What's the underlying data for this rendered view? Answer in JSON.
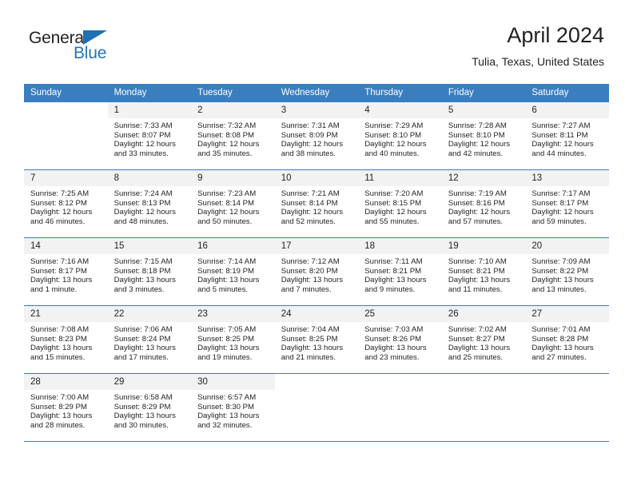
{
  "brand": {
    "word_one": "General",
    "word_two": "Blue",
    "flag_icon": "blue-triangle-flag-icon"
  },
  "header": {
    "title": "April 2024",
    "subtitle": "Tulia, Texas, United States"
  },
  "theme": {
    "header_blue": "#3a7ebf",
    "daynum_gray": "#f2f2f2",
    "brand_blue": "#2176b9",
    "text": "#231f20"
  },
  "weekday_headers": [
    "Sunday",
    "Monday",
    "Tuesday",
    "Wednesday",
    "Thursday",
    "Friday",
    "Saturday"
  ],
  "weeks": [
    [
      {
        "day": "",
        "sunrise": "",
        "sunset": "",
        "daylight1": "",
        "daylight2": "",
        "blank": true
      },
      {
        "day": "1",
        "sunrise": "Sunrise: 7:33 AM",
        "sunset": "Sunset: 8:07 PM",
        "daylight1": "Daylight: 12 hours",
        "daylight2": "and 33 minutes."
      },
      {
        "day": "2",
        "sunrise": "Sunrise: 7:32 AM",
        "sunset": "Sunset: 8:08 PM",
        "daylight1": "Daylight: 12 hours",
        "daylight2": "and 35 minutes."
      },
      {
        "day": "3",
        "sunrise": "Sunrise: 7:31 AM",
        "sunset": "Sunset: 8:09 PM",
        "daylight1": "Daylight: 12 hours",
        "daylight2": "and 38 minutes."
      },
      {
        "day": "4",
        "sunrise": "Sunrise: 7:29 AM",
        "sunset": "Sunset: 8:10 PM",
        "daylight1": "Daylight: 12 hours",
        "daylight2": "and 40 minutes."
      },
      {
        "day": "5",
        "sunrise": "Sunrise: 7:28 AM",
        "sunset": "Sunset: 8:10 PM",
        "daylight1": "Daylight: 12 hours",
        "daylight2": "and 42 minutes."
      },
      {
        "day": "6",
        "sunrise": "Sunrise: 7:27 AM",
        "sunset": "Sunset: 8:11 PM",
        "daylight1": "Daylight: 12 hours",
        "daylight2": "and 44 minutes."
      }
    ],
    [
      {
        "day": "7",
        "sunrise": "Sunrise: 7:25 AM",
        "sunset": "Sunset: 8:12 PM",
        "daylight1": "Daylight: 12 hours",
        "daylight2": "and 46 minutes."
      },
      {
        "day": "8",
        "sunrise": "Sunrise: 7:24 AM",
        "sunset": "Sunset: 8:13 PM",
        "daylight1": "Daylight: 12 hours",
        "daylight2": "and 48 minutes."
      },
      {
        "day": "9",
        "sunrise": "Sunrise: 7:23 AM",
        "sunset": "Sunset: 8:14 PM",
        "daylight1": "Daylight: 12 hours",
        "daylight2": "and 50 minutes."
      },
      {
        "day": "10",
        "sunrise": "Sunrise: 7:21 AM",
        "sunset": "Sunset: 8:14 PM",
        "daylight1": "Daylight: 12 hours",
        "daylight2": "and 52 minutes."
      },
      {
        "day": "11",
        "sunrise": "Sunrise: 7:20 AM",
        "sunset": "Sunset: 8:15 PM",
        "daylight1": "Daylight: 12 hours",
        "daylight2": "and 55 minutes."
      },
      {
        "day": "12",
        "sunrise": "Sunrise: 7:19 AM",
        "sunset": "Sunset: 8:16 PM",
        "daylight1": "Daylight: 12 hours",
        "daylight2": "and 57 minutes."
      },
      {
        "day": "13",
        "sunrise": "Sunrise: 7:17 AM",
        "sunset": "Sunset: 8:17 PM",
        "daylight1": "Daylight: 12 hours",
        "daylight2": "and 59 minutes."
      }
    ],
    [
      {
        "day": "14",
        "sunrise": "Sunrise: 7:16 AM",
        "sunset": "Sunset: 8:17 PM",
        "daylight1": "Daylight: 13 hours",
        "daylight2": "and 1 minute."
      },
      {
        "day": "15",
        "sunrise": "Sunrise: 7:15 AM",
        "sunset": "Sunset: 8:18 PM",
        "daylight1": "Daylight: 13 hours",
        "daylight2": "and 3 minutes."
      },
      {
        "day": "16",
        "sunrise": "Sunrise: 7:14 AM",
        "sunset": "Sunset: 8:19 PM",
        "daylight1": "Daylight: 13 hours",
        "daylight2": "and 5 minutes."
      },
      {
        "day": "17",
        "sunrise": "Sunrise: 7:12 AM",
        "sunset": "Sunset: 8:20 PM",
        "daylight1": "Daylight: 13 hours",
        "daylight2": "and 7 minutes."
      },
      {
        "day": "18",
        "sunrise": "Sunrise: 7:11 AM",
        "sunset": "Sunset: 8:21 PM",
        "daylight1": "Daylight: 13 hours",
        "daylight2": "and 9 minutes."
      },
      {
        "day": "19",
        "sunrise": "Sunrise: 7:10 AM",
        "sunset": "Sunset: 8:21 PM",
        "daylight1": "Daylight: 13 hours",
        "daylight2": "and 11 minutes."
      },
      {
        "day": "20",
        "sunrise": "Sunrise: 7:09 AM",
        "sunset": "Sunset: 8:22 PM",
        "daylight1": "Daylight: 13 hours",
        "daylight2": "and 13 minutes."
      }
    ],
    [
      {
        "day": "21",
        "sunrise": "Sunrise: 7:08 AM",
        "sunset": "Sunset: 8:23 PM",
        "daylight1": "Daylight: 13 hours",
        "daylight2": "and 15 minutes."
      },
      {
        "day": "22",
        "sunrise": "Sunrise: 7:06 AM",
        "sunset": "Sunset: 8:24 PM",
        "daylight1": "Daylight: 13 hours",
        "daylight2": "and 17 minutes."
      },
      {
        "day": "23",
        "sunrise": "Sunrise: 7:05 AM",
        "sunset": "Sunset: 8:25 PM",
        "daylight1": "Daylight: 13 hours",
        "daylight2": "and 19 minutes."
      },
      {
        "day": "24",
        "sunrise": "Sunrise: 7:04 AM",
        "sunset": "Sunset: 8:25 PM",
        "daylight1": "Daylight: 13 hours",
        "daylight2": "and 21 minutes."
      },
      {
        "day": "25",
        "sunrise": "Sunrise: 7:03 AM",
        "sunset": "Sunset: 8:26 PM",
        "daylight1": "Daylight: 13 hours",
        "daylight2": "and 23 minutes."
      },
      {
        "day": "26",
        "sunrise": "Sunrise: 7:02 AM",
        "sunset": "Sunset: 8:27 PM",
        "daylight1": "Daylight: 13 hours",
        "daylight2": "and 25 minutes."
      },
      {
        "day": "27",
        "sunrise": "Sunrise: 7:01 AM",
        "sunset": "Sunset: 8:28 PM",
        "daylight1": "Daylight: 13 hours",
        "daylight2": "and 27 minutes."
      }
    ],
    [
      {
        "day": "28",
        "sunrise": "Sunrise: 7:00 AM",
        "sunset": "Sunset: 8:29 PM",
        "daylight1": "Daylight: 13 hours",
        "daylight2": "and 28 minutes."
      },
      {
        "day": "29",
        "sunrise": "Sunrise: 6:58 AM",
        "sunset": "Sunset: 8:29 PM",
        "daylight1": "Daylight: 13 hours",
        "daylight2": "and 30 minutes."
      },
      {
        "day": "30",
        "sunrise": "Sunrise: 6:57 AM",
        "sunset": "Sunset: 8:30 PM",
        "daylight1": "Daylight: 13 hours",
        "daylight2": "and 32 minutes."
      },
      {
        "day": "",
        "sunrise": "",
        "sunset": "",
        "daylight1": "",
        "daylight2": "",
        "blank": true
      },
      {
        "day": "",
        "sunrise": "",
        "sunset": "",
        "daylight1": "",
        "daylight2": "",
        "blank": true
      },
      {
        "day": "",
        "sunrise": "",
        "sunset": "",
        "daylight1": "",
        "daylight2": "",
        "blank": true
      },
      {
        "day": "",
        "sunrise": "",
        "sunset": "",
        "daylight1": "",
        "daylight2": "",
        "blank": true
      }
    ]
  ]
}
